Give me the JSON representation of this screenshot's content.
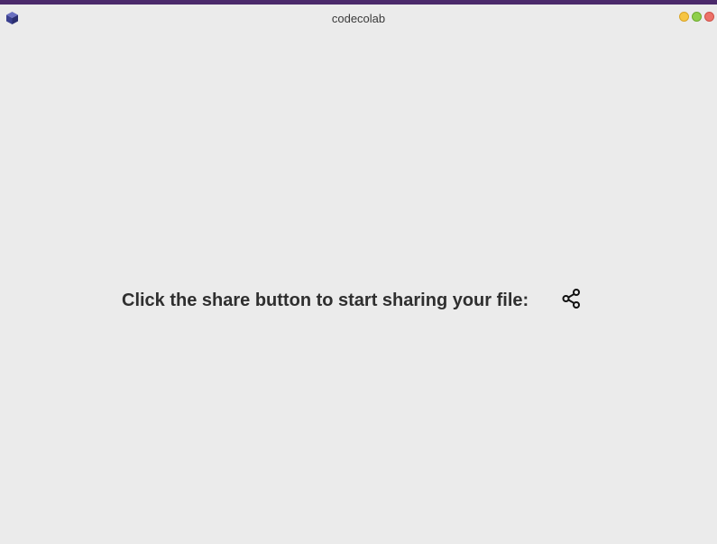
{
  "window": {
    "title": "codecolab",
    "accent_color": "#4b2a6b",
    "logo_icon": "cube-icon",
    "controls": [
      {
        "name": "minimize",
        "color": "#f6c544"
      },
      {
        "name": "maximize",
        "color": "#8fcf4b"
      },
      {
        "name": "close",
        "color": "#ec7168"
      }
    ]
  },
  "main": {
    "prompt": "Click the share button to start sharing your file:",
    "share_icon": "share-icon"
  }
}
